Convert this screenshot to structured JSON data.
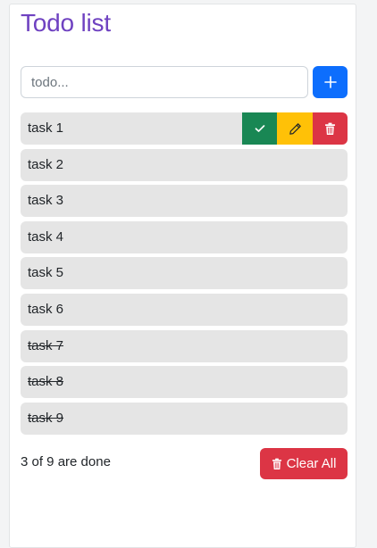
{
  "app": {
    "title": "Todo list"
  },
  "input": {
    "value": "",
    "placeholder": "todo..."
  },
  "add_button": {
    "icon": "plus-icon"
  },
  "tasks": [
    {
      "label": "task 1",
      "done": false
    },
    {
      "label": "task 2",
      "done": false
    },
    {
      "label": "task 3",
      "done": false
    },
    {
      "label": "task 4",
      "done": false
    },
    {
      "label": "task 5",
      "done": false
    },
    {
      "label": "task 6",
      "done": false
    },
    {
      "label": "task 7",
      "done": true
    },
    {
      "label": "task 8",
      "done": true
    },
    {
      "label": "task 9",
      "done": true
    }
  ],
  "task_actions": {
    "icons": [
      "check-icon",
      "pencil-icon",
      "trash-icon"
    ]
  },
  "footer": {
    "count_text": "3 of 9 are done",
    "clear_label": "Clear All"
  },
  "colors": {
    "title": "#6f42c1",
    "primary": "#0d6efd",
    "success": "#198754",
    "warning": "#ffc107",
    "danger": "#dc3545",
    "item_bg": "#e5e5e5"
  }
}
